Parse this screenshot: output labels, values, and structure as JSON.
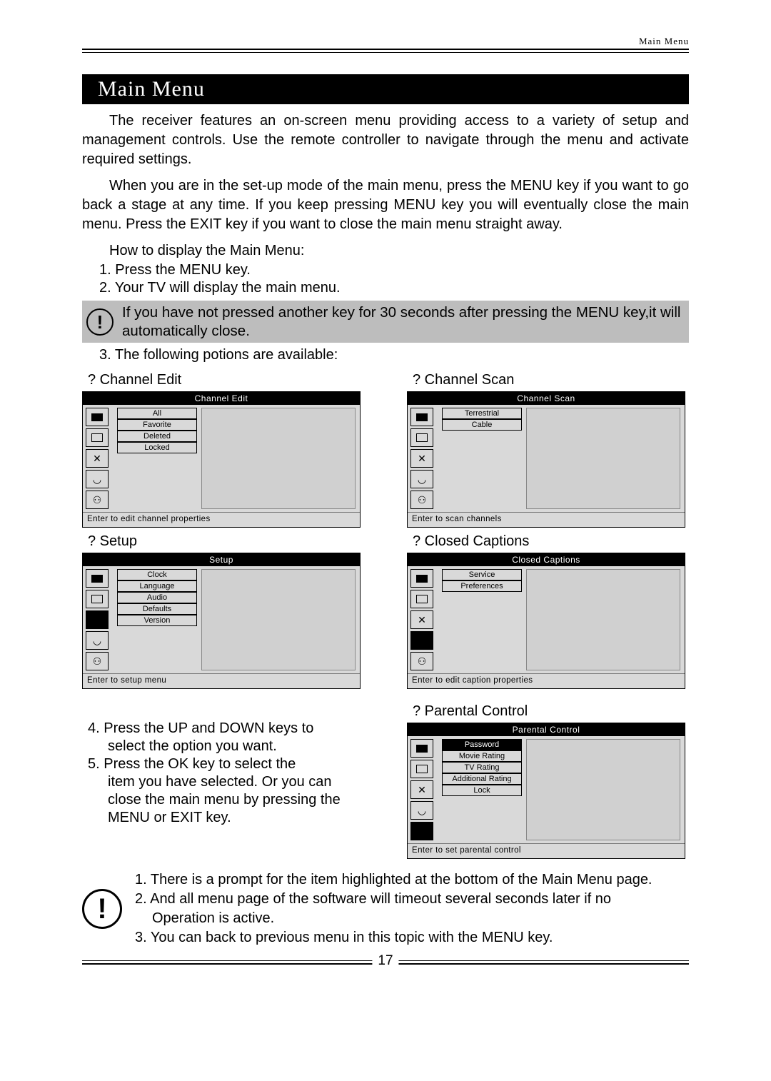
{
  "header_label": "Main Menu",
  "title": "Main Menu",
  "para1": "The receiver features an on-screen menu providing access to a variety of setup and management controls. Use the remote controller to navigate through the menu and activate required settings.",
  "para2": "When you are in the set-up mode of the main menu, press the MENU key if you want to go back a stage at any time. If you keep pressing MENU key you will eventually close the main menu. Press the EXIT key if you want to close the main menu straight away.",
  "howto": "How to display the Main Menu:",
  "step1": "1.  Press the MENU key.",
  "step2": "2.  Your TV will display the main menu.",
  "callout1": "If you have not pressed another key for 30 seconds  after pressing the MENU key,it   will automatically close.",
  "step3": "3.  The following potions are available:",
  "q_channel_edit": "?     Channel Edit",
  "q_channel_scan": "?     Channel Scan",
  "q_setup": "?     Setup",
  "q_cc": "?     Closed Captions",
  "q_pc": "?     Parental Control",
  "menus": {
    "channel_edit": {
      "title": "Channel Edit",
      "opts": [
        "All",
        "Favorite",
        "Deleted",
        "Locked"
      ],
      "foot": "Enter to edit channel properties"
    },
    "channel_scan": {
      "title": "Channel Scan",
      "opts": [
        "Terrestrial",
        "Cable"
      ],
      "foot": "Enter to scan channels"
    },
    "setup": {
      "title": "Setup",
      "opts": [
        "Clock",
        "Language",
        "Audio",
        "Defaults",
        "Version"
      ],
      "foot": "Enter to setup menu"
    },
    "cc": {
      "title": "Closed Captions",
      "opts": [
        "Service",
        "Preferences"
      ],
      "foot": "Enter to edit caption properties"
    },
    "pc": {
      "title": "Parental Control",
      "opts": [
        "Password",
        "Movie Rating",
        "TV Rating",
        "Additional Rating",
        "Lock"
      ],
      "foot": "Enter to set parental control"
    }
  },
  "step4a": "4.  Press the UP  and DOWN keys to",
  "step4b": "select the option you want.",
  "step5a": "5.  Press the OK key to select the",
  "step5b": "item you have selected. Or you can",
  "step5c": "close   the main menu by pressing the",
  "step5d": "MENU  or EXIT key.",
  "note1": "1. There is a prompt for the item highlighted at the bottom of the Main Menu page.",
  "note2": "2. And all menu page of the software will timeout several seconds later if no",
  "note2b": "Operation is active.",
  "note3": "3. You can back to previous menu in this topic with the MENU key.",
  "page_number": "17"
}
